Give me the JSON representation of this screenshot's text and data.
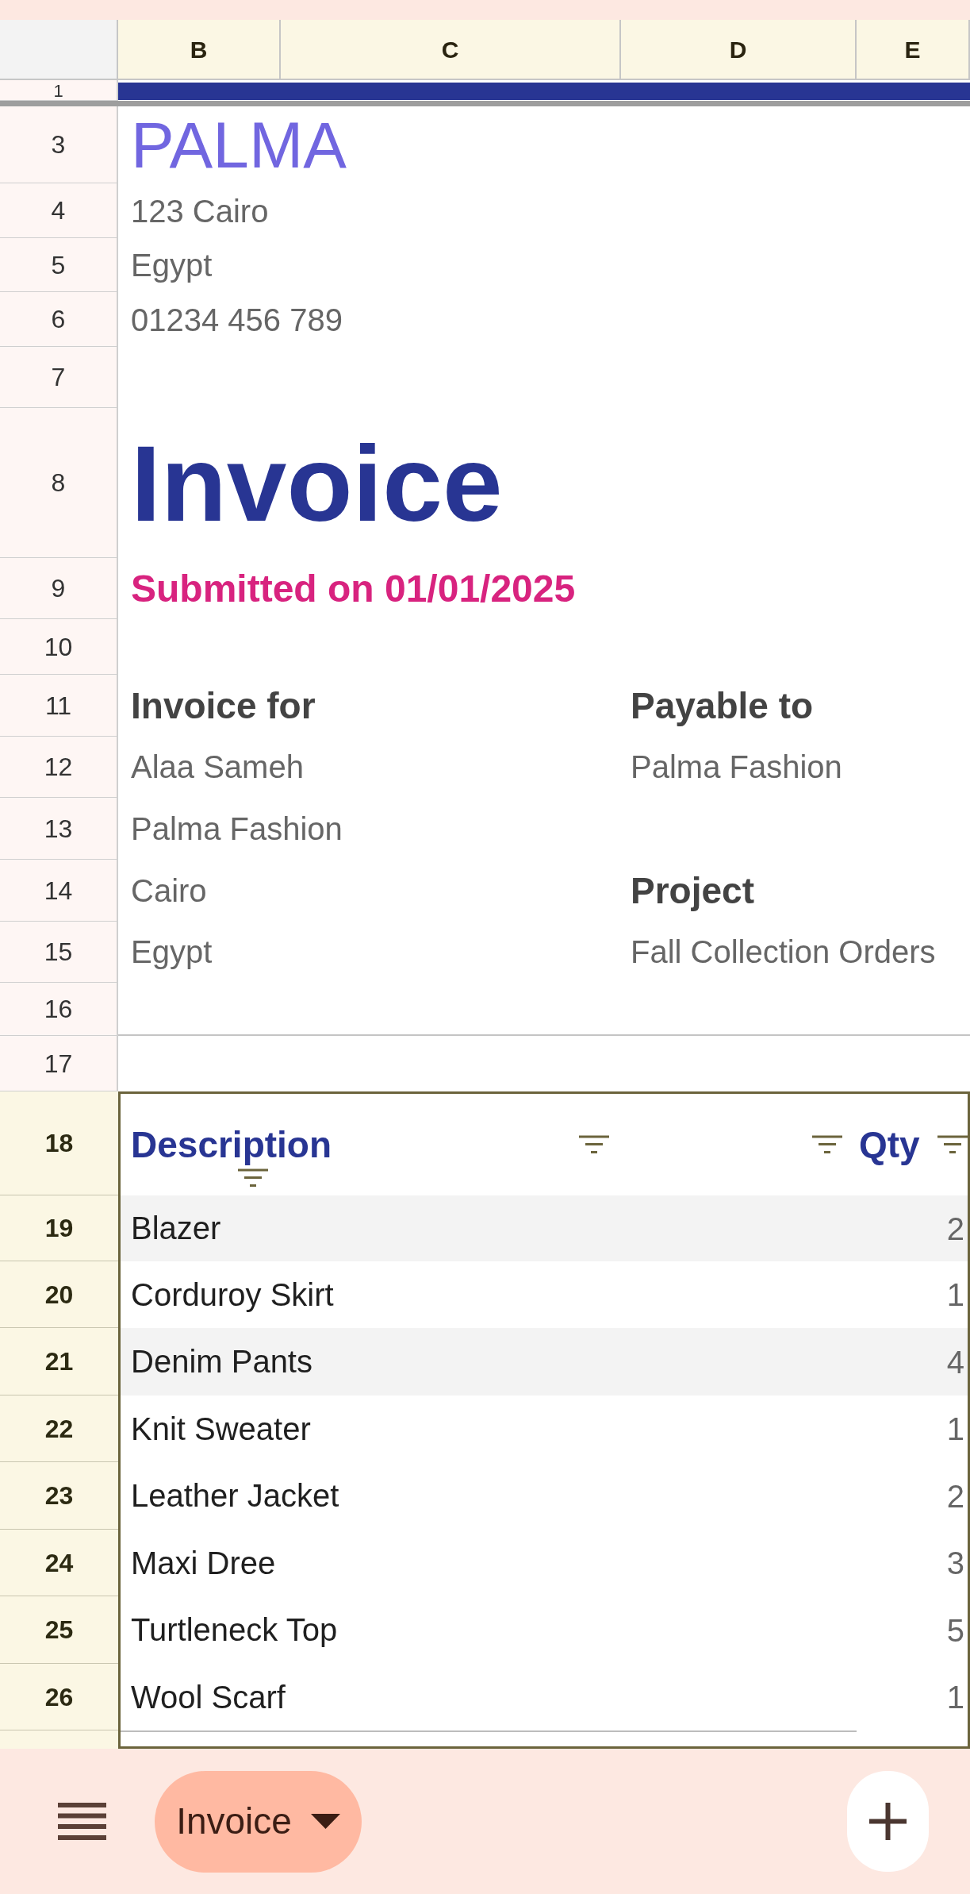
{
  "column_headers": [
    {
      "label": "B",
      "selected": true
    },
    {
      "label": "C",
      "selected": true
    },
    {
      "label": "D",
      "selected": true
    },
    {
      "label": "E",
      "selected": true
    }
  ],
  "row_numbers": [
    {
      "label": "1",
      "selected": false
    },
    {
      "label": "3",
      "selected": false
    },
    {
      "label": "4",
      "selected": false
    },
    {
      "label": "5",
      "selected": false
    },
    {
      "label": "6",
      "selected": false
    },
    {
      "label": "7",
      "selected": false
    },
    {
      "label": "8",
      "selected": false
    },
    {
      "label": "9",
      "selected": false
    },
    {
      "label": "10",
      "selected": false
    },
    {
      "label": "11",
      "selected": false
    },
    {
      "label": "12",
      "selected": false
    },
    {
      "label": "13",
      "selected": false
    },
    {
      "label": "14",
      "selected": false
    },
    {
      "label": "15",
      "selected": false
    },
    {
      "label": "16",
      "selected": false
    },
    {
      "label": "17",
      "selected": false
    },
    {
      "label": "18",
      "selected": true
    },
    {
      "label": "19",
      "selected": true
    },
    {
      "label": "20",
      "selected": true
    },
    {
      "label": "21",
      "selected": true
    },
    {
      "label": "22",
      "selected": true
    },
    {
      "label": "23",
      "selected": true
    },
    {
      "label": "24",
      "selected": true
    },
    {
      "label": "25",
      "selected": true
    },
    {
      "label": "26",
      "selected": true
    }
  ],
  "company": {
    "name": "PALMA",
    "address_lines": [
      "123 Cairo",
      "Egypt",
      "01234 456 789"
    ]
  },
  "invoice_title": "Invoice",
  "submitted": "Submitted on 01/01/2025",
  "invoice_for": {
    "heading": "Invoice for",
    "lines": [
      "Alaa Sameh",
      "Palma Fashion",
      "Cairo",
      "Egypt"
    ]
  },
  "payable_to": {
    "heading": "Payable to",
    "lines": [
      "Palma Fashion"
    ]
  },
  "project": {
    "heading": "Project",
    "lines": [
      "Fall Collection Orders"
    ]
  },
  "table": {
    "columns": [
      {
        "label": "Description",
        "filter": true
      },
      {
        "filter": true
      },
      {
        "filter": true
      },
      {
        "label": "Qty",
        "filter": true
      }
    ],
    "rows": [
      {
        "description": "Blazer",
        "qty": "2",
        "shaded": true
      },
      {
        "description": "Corduroy Skirt",
        "qty": "1",
        "shaded": false
      },
      {
        "description": "Denim Pants",
        "qty": "4",
        "shaded": true
      },
      {
        "description": "Knit Sweater",
        "qty": "1",
        "shaded": false
      },
      {
        "description": "Leather Jacket",
        "qty": "2",
        "shaded": false
      },
      {
        "description": "Maxi Dree",
        "qty": "3",
        "shaded": false
      },
      {
        "description": "Turtleneck Top",
        "qty": "5",
        "shaded": false
      },
      {
        "description": "Wool Scarf",
        "qty": "1",
        "shaded": false
      }
    ]
  },
  "bottom_bar": {
    "sheet_tabs": [
      {
        "label": "Invoice",
        "selected": true
      }
    ]
  }
}
